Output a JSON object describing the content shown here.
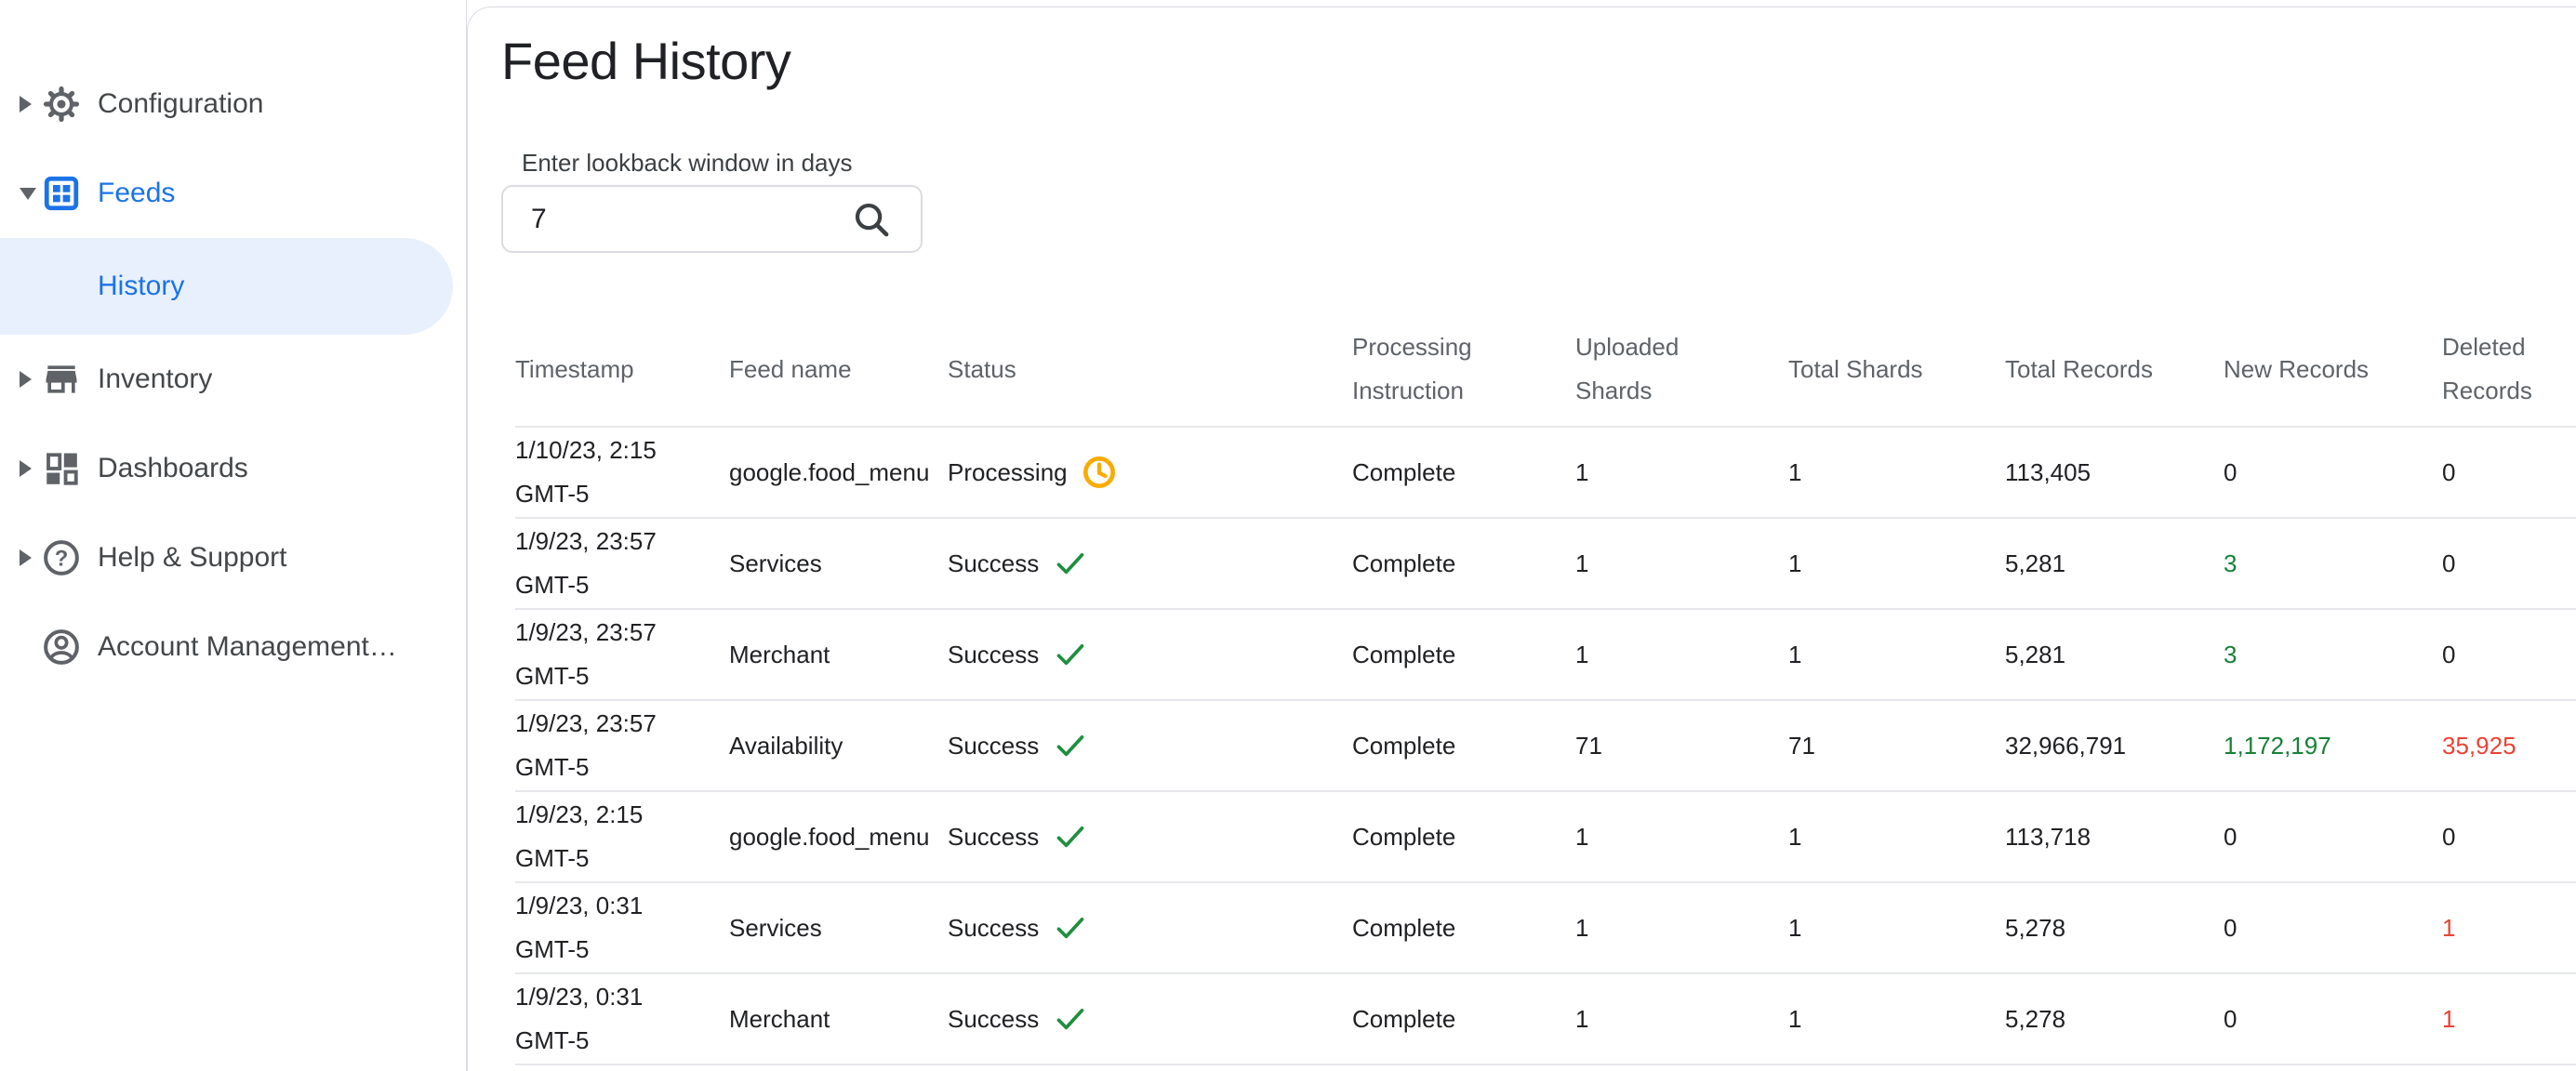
{
  "header": {
    "title": "Feed History"
  },
  "sidebar": {
    "items": [
      {
        "label": "Configuration",
        "icon": "gear-icon",
        "state": "collapsed"
      },
      {
        "label": "Feeds",
        "icon": "feeds-icon",
        "state": "expanded"
      },
      {
        "label": "History",
        "state": "selected-subitem"
      },
      {
        "label": "Inventory",
        "icon": "storefront-icon",
        "state": "collapsed"
      },
      {
        "label": "Dashboards",
        "icon": "dashboard-icon",
        "state": "collapsed"
      },
      {
        "label": "Help & Support",
        "icon": "help-icon",
        "state": "collapsed"
      },
      {
        "label": "Account Management…",
        "icon": "account-icon",
        "state": "none"
      }
    ]
  },
  "search": {
    "label": "Enter lookback window in days",
    "value": "7",
    "icon": "search-icon"
  },
  "table": {
    "columns": [
      "Timestamp",
      "Feed name",
      "Status",
      "Processing Instruction",
      "Uploaded Shards",
      "Total Shards",
      "Total Records",
      "New Records",
      "Deleted Records"
    ],
    "rows": [
      {
        "timestamp": "1/10/23, 2:15 GMT-5",
        "feed_name": "google.food_menu",
        "status": "Processing",
        "status_icon": "clock-icon",
        "processing_instruction": "Complete",
        "uploaded_shards": "1",
        "total_shards": "1",
        "total_records": "113,405",
        "new_records": "0",
        "new_records_color": "default",
        "deleted_records": "0",
        "deleted_records_color": "default"
      },
      {
        "timestamp": "1/9/23, 23:57 GMT-5",
        "feed_name": "Services",
        "status": "Success",
        "status_icon": "check-icon",
        "processing_instruction": "Complete",
        "uploaded_shards": "1",
        "total_shards": "1",
        "total_records": "5,281",
        "new_records": "3",
        "new_records_color": "green",
        "deleted_records": "0",
        "deleted_records_color": "default"
      },
      {
        "timestamp": "1/9/23, 23:57 GMT-5",
        "feed_name": "Merchant",
        "status": "Success",
        "status_icon": "check-icon",
        "processing_instruction": "Complete",
        "uploaded_shards": "1",
        "total_shards": "1",
        "total_records": "5,281",
        "new_records": "3",
        "new_records_color": "green",
        "deleted_records": "0",
        "deleted_records_color": "default"
      },
      {
        "timestamp": "1/9/23, 23:57 GMT-5",
        "feed_name": "Availability",
        "status": "Success",
        "status_icon": "check-icon",
        "processing_instruction": "Complete",
        "uploaded_shards": "71",
        "total_shards": "71",
        "total_records": "32,966,791",
        "new_records": "1,172,197",
        "new_records_color": "green",
        "deleted_records": "35,925",
        "deleted_records_color": "red"
      },
      {
        "timestamp": "1/9/23, 2:15 GMT-5",
        "feed_name": "google.food_menu",
        "status": "Success",
        "status_icon": "check-icon",
        "processing_instruction": "Complete",
        "uploaded_shards": "1",
        "total_shards": "1",
        "total_records": "113,718",
        "new_records": "0",
        "new_records_color": "default",
        "deleted_records": "0",
        "deleted_records_color": "default"
      },
      {
        "timestamp": "1/9/23, 0:31 GMT-5",
        "feed_name": "Services",
        "status": "Success",
        "status_icon": "check-icon",
        "processing_instruction": "Complete",
        "uploaded_shards": "1",
        "total_shards": "1",
        "total_records": "5,278",
        "new_records": "0",
        "new_records_color": "default",
        "deleted_records": "1",
        "deleted_records_color": "red"
      },
      {
        "timestamp": "1/9/23, 0:31 GMT-5",
        "feed_name": "Merchant",
        "status": "Success",
        "status_icon": "check-icon",
        "processing_instruction": "Complete",
        "uploaded_shards": "1",
        "total_shards": "1",
        "total_records": "5,278",
        "new_records": "0",
        "new_records_color": "default",
        "deleted_records": "1",
        "deleted_records_color": "red"
      }
    ]
  },
  "colors": {
    "accent": "#1a73e8",
    "selected_bg": "#e8f0fe",
    "success_green": "#188038",
    "error_red": "#ea4335",
    "processing_amber": "#f9ab00",
    "text": "#202124",
    "muted": "#5f6368",
    "border": "#dadce0"
  }
}
